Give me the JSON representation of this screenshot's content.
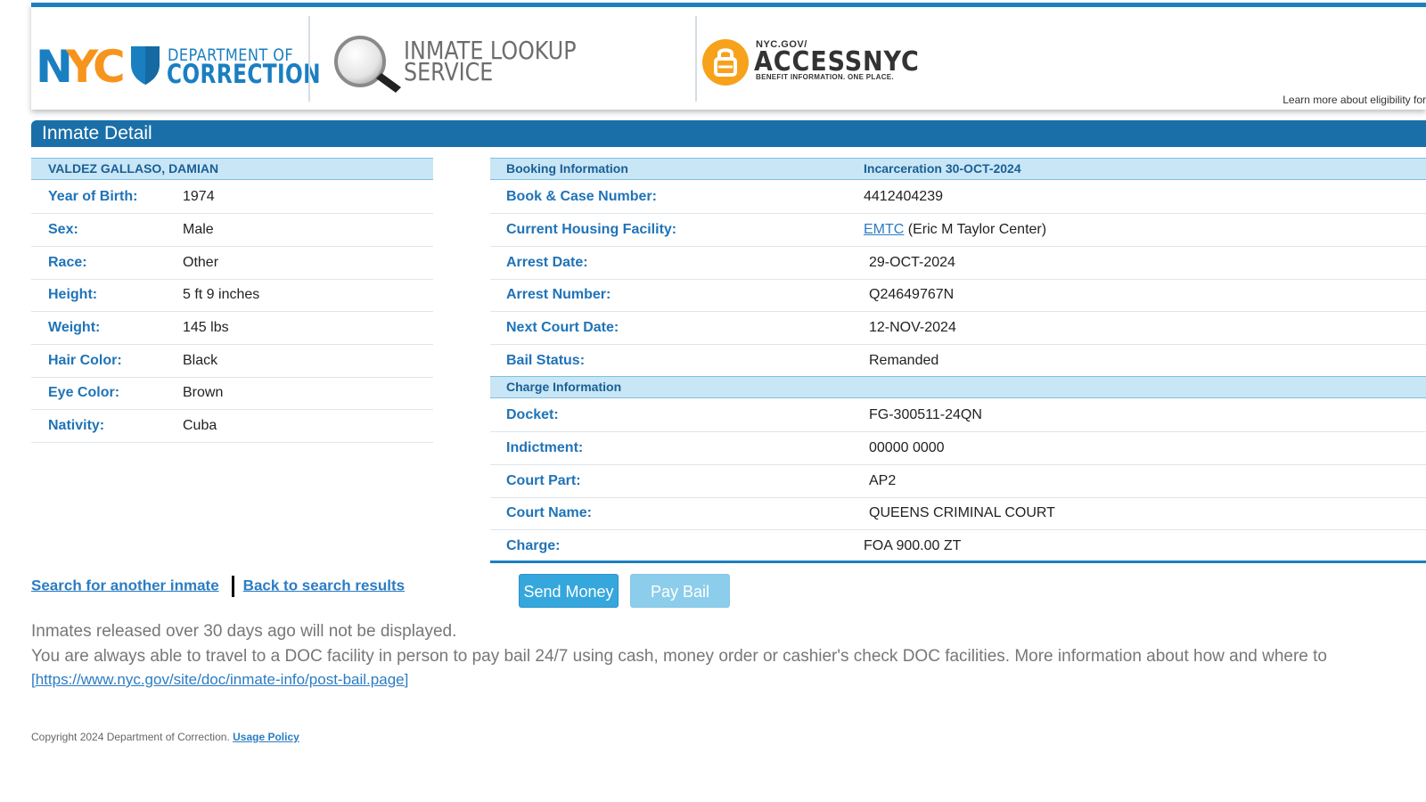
{
  "header": {
    "doc_line1": "DEPARTMENT OF",
    "doc_line2": "CORRECTION",
    "ils_line1": "INMATE LOOKUP",
    "ils_line2": "SERVICE",
    "access_small": "NYC.GOV/",
    "access_big": "ACCESSNYC",
    "access_tag": "BENEFIT INFORMATION. ONE PLACE.",
    "learn_more": "Learn more about eligibility for",
    "colors": {
      "nyc_blue": "#1a7fc1",
      "nyc_orange": "#f7941d",
      "access_orange": "#f7a21b"
    }
  },
  "title": "Inmate Detail",
  "inmate": {
    "name": "VALDEZ GALLASO, DAMIAN",
    "fields": [
      {
        "label": "Year of Birth:",
        "value": "1974"
      },
      {
        "label": "Sex:",
        "value": "Male"
      },
      {
        "label": "Race:",
        "value": "Other"
      },
      {
        "label": "Height:",
        "value": "5 ft 9 inches"
      },
      {
        "label": "Weight:",
        "value": "145 lbs"
      },
      {
        "label": "Hair Color:",
        "value": "Black"
      },
      {
        "label": "Eye Color:",
        "value": "Brown"
      },
      {
        "label": "Nativity:",
        "value": "Cuba"
      }
    ]
  },
  "booking": {
    "heading": "Booking Information",
    "incarceration": "Incarceration 30-OCT-2024",
    "book_case_label": "Book & Case Number:",
    "book_case_value": "4412404239",
    "facility_label": "Current Housing Facility:",
    "facility_link": "EMTC",
    "facility_name": "(Eric M Taylor Center)",
    "arrest_date_label": "Arrest Date:",
    "arrest_date_value": "29-OCT-2024",
    "arrest_number_label": "Arrest Number:",
    "arrest_number_value": "Q24649767N",
    "next_court_label": "Next Court Date:",
    "next_court_value": "12-NOV-2024",
    "bail_status_label": "Bail Status:",
    "bail_status_value": "Remanded"
  },
  "charge": {
    "heading": "Charge Information",
    "fields": [
      {
        "label": "Docket:",
        "value": "FG-300511-24QN"
      },
      {
        "label": "Indictment:",
        "value": "00000 0000"
      },
      {
        "label": "Court Part:",
        "value": "AP2"
      },
      {
        "label": "Court Name:",
        "value": "QUEENS CRIMINAL COURT"
      },
      {
        "label": "Charge:",
        "value": "FOA 900.00 ZT"
      }
    ]
  },
  "links": {
    "search_another": "Search for another inmate",
    "back_results": "Back to search results"
  },
  "buttons": {
    "send_money": "Send Money",
    "pay_bail": "Pay Bail"
  },
  "notes": {
    "released": "Inmates released over 30 days ago will not be displayed.",
    "travel": "You are always able to travel to a DOC facility in person to pay bail 24/7 using cash, money order or cashier's check DOC facilities. More information about how and where to",
    "url": "[https://www.nyc.gov/site/doc/inmate-info/post-bail.page]"
  },
  "footer": {
    "copyright": "Copyright 2024 Department of Correction.",
    "usage_policy": "Usage Policy"
  }
}
